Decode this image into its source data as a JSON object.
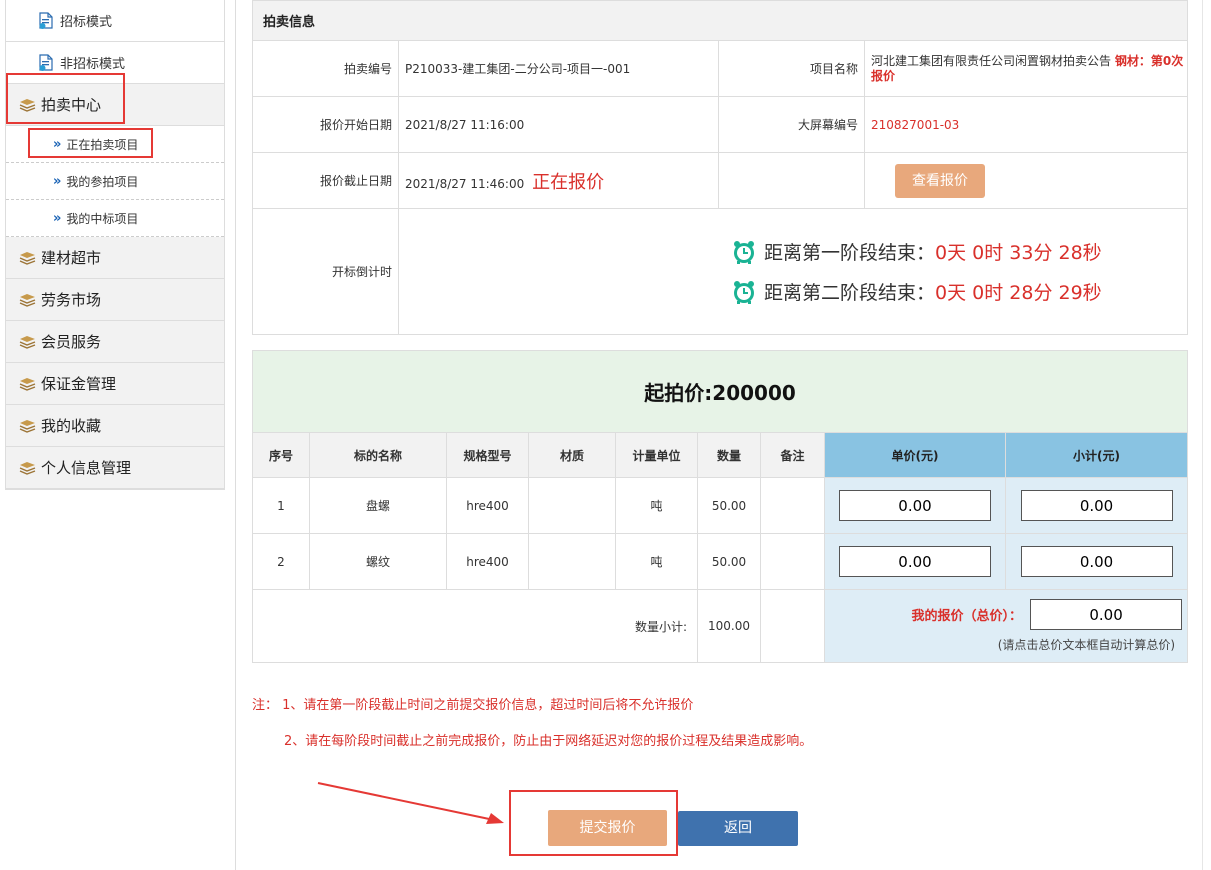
{
  "sidebar": {
    "top_items": [
      {
        "label": "招标模式",
        "icon": "document-icon"
      },
      {
        "label": "非招标模式",
        "icon": "document-icon"
      }
    ],
    "auction_section": {
      "label": "拍卖中心",
      "icon": "books-icon"
    },
    "auction_items": [
      {
        "label": "正在拍卖项目"
      },
      {
        "label": "我的参拍项目"
      },
      {
        "label": "我的中标项目"
      }
    ],
    "sections": [
      {
        "label": "建材超市"
      },
      {
        "label": "劳务市场"
      },
      {
        "label": "会员服务"
      },
      {
        "label": "保证金管理"
      },
      {
        "label": "我的收藏"
      },
      {
        "label": "个人信息管理"
      }
    ]
  },
  "info": {
    "header": "拍卖信息",
    "auction_no_label": "拍卖编号",
    "auction_no": "P210033-建工集团-二分公司-项目一-001",
    "project_name_label": "项目名称",
    "project_name": "河北建工集团有限责任公司闲置钢材拍卖公告",
    "project_tag": "钢材：第0次报价",
    "start_date_label": "报价开始日期",
    "start_date": "2021/8/27 11:16:00",
    "screen_no_label": "大屏幕编号",
    "screen_no": "210827001-03",
    "end_date_label": "报价截止日期",
    "end_date": "2021/8/27 11:46:00",
    "status": "正在报价",
    "view_button": "查看报价",
    "countdown_label": "开标倒计时",
    "stage1_label": "距离第一阶段结束：",
    "stage1_value": "0天 0时 33分 28秒",
    "stage2_label": "距离第二阶段结束：",
    "stage2_value": "0天 0时 28分 29秒"
  },
  "bid": {
    "start_price": "起拍价:200000",
    "headers": [
      "序号",
      "标的名称",
      "规格型号",
      "材质",
      "计量单位",
      "数量",
      "备注",
      "单价(元)",
      "小计(元)"
    ],
    "rows": [
      {
        "no": "1",
        "name": "盘螺",
        "spec": "hre400",
        "material": "",
        "unit": "吨",
        "qty": "50.00",
        "note": "",
        "unit_price": "0.00",
        "subtotal": "0.00"
      },
      {
        "no": "2",
        "name": "螺纹",
        "spec": "hre400",
        "material": "",
        "unit": "吨",
        "qty": "50.00",
        "note": "",
        "unit_price": "0.00",
        "subtotal": "0.00"
      }
    ],
    "qty_subtotal_label": "数量小计:",
    "qty_subtotal": "100.00",
    "my_total_label": "我的报价（总价）：",
    "my_total": "0.00",
    "total_hint": "(请点击总价文本框自动计算总价)"
  },
  "notes": {
    "line1": "注： 1、请在第一阶段截止时间之前提交报价信息，超过时间后将不允许报价",
    "line2": "2、请在每阶段时间截止之前完成报价，防止由于网络延迟对您的报价过程及结果造成影响。"
  },
  "actions": {
    "submit": "提交报价",
    "back": "返回"
  },
  "colors": {
    "accent_red": "#d9302b",
    "highlight_red": "#e53935",
    "submit_orange": "#e8a87c",
    "back_blue": "#3f72ae",
    "header_blue": "#89c3e2"
  }
}
